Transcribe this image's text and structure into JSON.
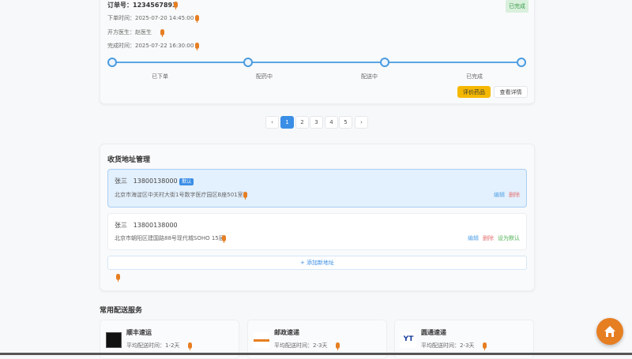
{
  "order": {
    "number_label": "订单号：",
    "number": "1234567893",
    "status": "已完成",
    "order_time": "下单时间：2025-07-20 14:45:00",
    "doctor": "开方医生：赵医生",
    "complete_time": "完成时间：2025-07-22 16:30:00",
    "steps": [
      "已下单",
      "配药中",
      "配送中",
      "已完成"
    ],
    "review_button": "评价药品",
    "detail_button": "查看详情"
  },
  "pagination": {
    "prev": "‹",
    "pages": [
      "1",
      "2",
      "3",
      "4",
      "5"
    ],
    "next": "›",
    "current": "1"
  },
  "address": {
    "title": "收货地址管理",
    "items": [
      {
        "name": "张三",
        "phone": "13800138000",
        "badge": "默认",
        "address": "北京市海淀区中关村大街1号数字医疗园区B座501室",
        "edit": "编辑",
        "delete": "删除"
      },
      {
        "name": "张三",
        "phone": "13800138000",
        "address": "北京市朝阳区建国路88号现代城SOHO 15层",
        "edit": "编辑",
        "delete": "删除",
        "set_default": "设为默认"
      }
    ],
    "add_button": "+ 添加新地址"
  },
  "services": {
    "title": "常用配送服务",
    "items": [
      {
        "name": "顺丰速运",
        "time": "平均配送时间：1-2天"
      },
      {
        "name": "邮政速递",
        "time": "平均配送时间：2-3天"
      },
      {
        "name": "圆通速递",
        "time": "平均配送时间：2-3天"
      }
    ]
  },
  "colors": {
    "primary": "#3a8ee6",
    "warning": "#f5b800",
    "mic": "#e67e22",
    "home": "#e67e22"
  }
}
